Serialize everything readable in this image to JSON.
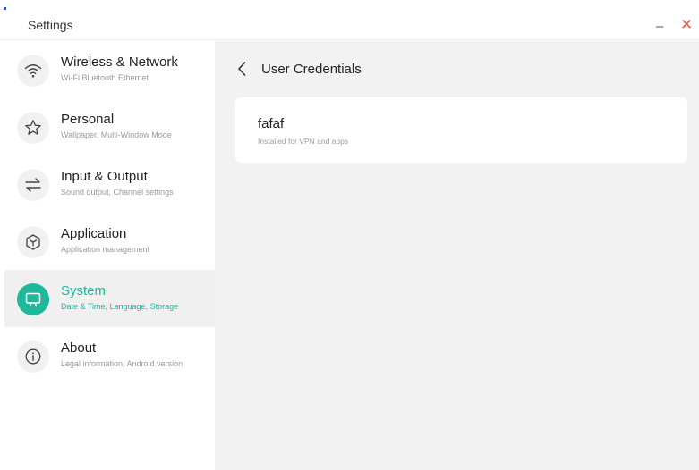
{
  "window": {
    "title": "Settings",
    "minimize_glyph": "–",
    "close_glyph": "✕",
    "close_color": "#e45b4a"
  },
  "sidebar": {
    "accent_color": "#1fb89b",
    "items": [
      {
        "label": "Wireless & Network",
        "sub": "Wi-Fi Bluetooth Ethernet",
        "icon": "wifi-icon",
        "active": false
      },
      {
        "label": "Personal",
        "sub": "Wallpaper, Multi-Window Mode",
        "icon": "star-icon",
        "active": false
      },
      {
        "label": "Input & Output",
        "sub": "Sound output, Channel settings",
        "icon": "swap-arrows-icon",
        "active": false
      },
      {
        "label": "Application",
        "sub": "Application management",
        "icon": "cube-icon",
        "active": false
      },
      {
        "label": "System",
        "sub": "Date & Time, Language, Storage",
        "icon": "monitor-icon",
        "active": true
      },
      {
        "label": "About",
        "sub": "Legal information, Android version",
        "icon": "info-icon",
        "active": false
      }
    ]
  },
  "main": {
    "page_title": "User Credentials",
    "credentials": [
      {
        "name": "fafaf",
        "description": "Installed for VPN and apps"
      }
    ]
  }
}
